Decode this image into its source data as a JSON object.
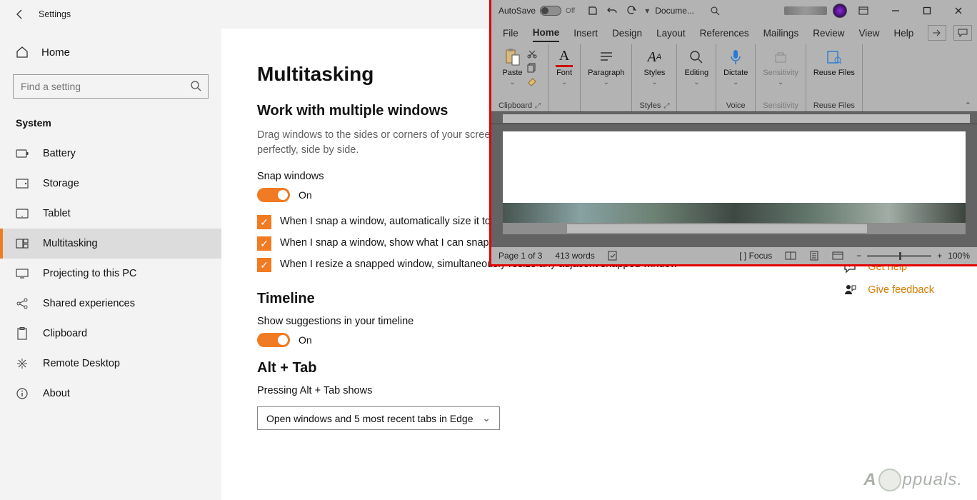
{
  "settings": {
    "title": "Settings",
    "home_label": "Home",
    "search_placeholder": "Find a setting",
    "section_heading": "System",
    "nav": [
      {
        "icon": "battery",
        "label": "Battery"
      },
      {
        "icon": "storage",
        "label": "Storage"
      },
      {
        "icon": "tablet",
        "label": "Tablet"
      },
      {
        "icon": "multitask",
        "label": "Multitasking"
      },
      {
        "icon": "project",
        "label": "Projecting to this PC"
      },
      {
        "icon": "shared",
        "label": "Shared experiences"
      },
      {
        "icon": "clipboard",
        "label": "Clipboard"
      },
      {
        "icon": "remote",
        "label": "Remote Desktop"
      },
      {
        "icon": "about",
        "label": "About"
      }
    ],
    "page": {
      "heading": "Multitasking",
      "sub1": "Work with multiple windows",
      "desc1": "Drag windows to the sides or corners of your screen and they'll automatically size to fit perfectly, side by side.",
      "snap_label": "Snap windows",
      "snap_state": "On",
      "checks": [
        "When I snap a window, automatically size it to fill available space",
        "When I snap a window, show what I can snap next to it",
        "When I resize a snapped window, simultaneously resize any adjacent snapped window"
      ],
      "sub2": "Timeline",
      "timeline_label": "Show suggestions in your timeline",
      "timeline_state": "On",
      "sub3": "Alt + Tab",
      "alttab_label": "Pressing Alt + Tab shows",
      "alttab_value": "Open windows and 5 most recent tabs in Edge"
    },
    "help": {
      "get": "Get help",
      "feedback": "Give feedback"
    }
  },
  "word": {
    "autosave_label": "AutoSave",
    "autosave_state": "Off",
    "doc_name": "Docume...",
    "menus": [
      "File",
      "Home",
      "Insert",
      "Design",
      "Layout",
      "References",
      "Mailings",
      "Review",
      "View",
      "Help"
    ],
    "active_menu": "Home",
    "ribbon": {
      "paste": "Paste",
      "clipboard_group": "Clipboard",
      "font": "Font",
      "paragraph": "Paragraph",
      "styles": "Styles",
      "styles_group": "Styles",
      "editing": "Editing",
      "dictate": "Dictate",
      "voice_group": "Voice",
      "sensitivity": "Sensitivity",
      "sensitivity_group": "Sensitivity",
      "reuse": "Reuse Files",
      "reuse_group": "Reuse Files"
    },
    "status": {
      "page": "Page 1 of 3",
      "words": "413 words",
      "focus": "Focus",
      "zoom": "100%"
    }
  },
  "watermark": "ppuals."
}
